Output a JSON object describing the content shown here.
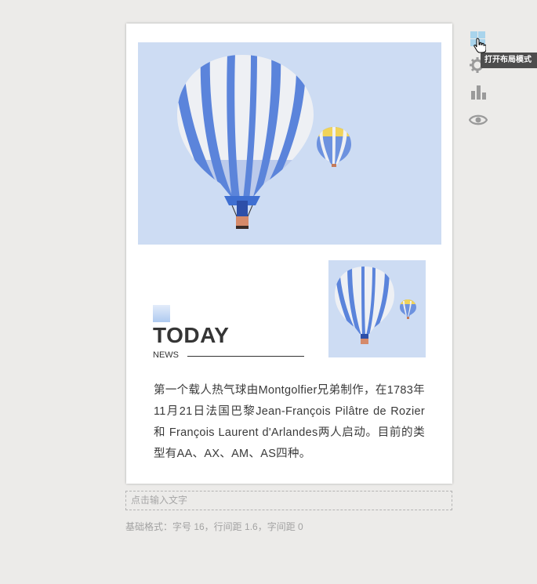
{
  "article": {
    "today_title": "TODAY",
    "news_label": "NEWS",
    "body": "第一个载人热气球由Montgolfier兄弟制作，在1783年11月21日法国巴黎Jean-François Pilâtre de Rozier 和 François Laurent d'Arlandes两人启动。目前的类型有AA、AX、AM、AS四种。"
  },
  "editor": {
    "input_placeholder": "点击输入文字",
    "format_info": "基础格式：字号 16，行间距 1.6，字间距 0"
  },
  "toolbar": {
    "tooltip": "打开布局模式",
    "icons": [
      "layout-grid-icon",
      "settings-gear-icon",
      "bar-chart-icon",
      "eye-preview-icon"
    ]
  },
  "colors": {
    "sky": "#cddcf3",
    "balloon_blue": "#5b84db",
    "balloon_white": "#eef0f4",
    "balloon_yellow": "#f0d35a",
    "toolbar_icon": "#9a9a9a",
    "layout_icon": "#a9d4ec"
  }
}
